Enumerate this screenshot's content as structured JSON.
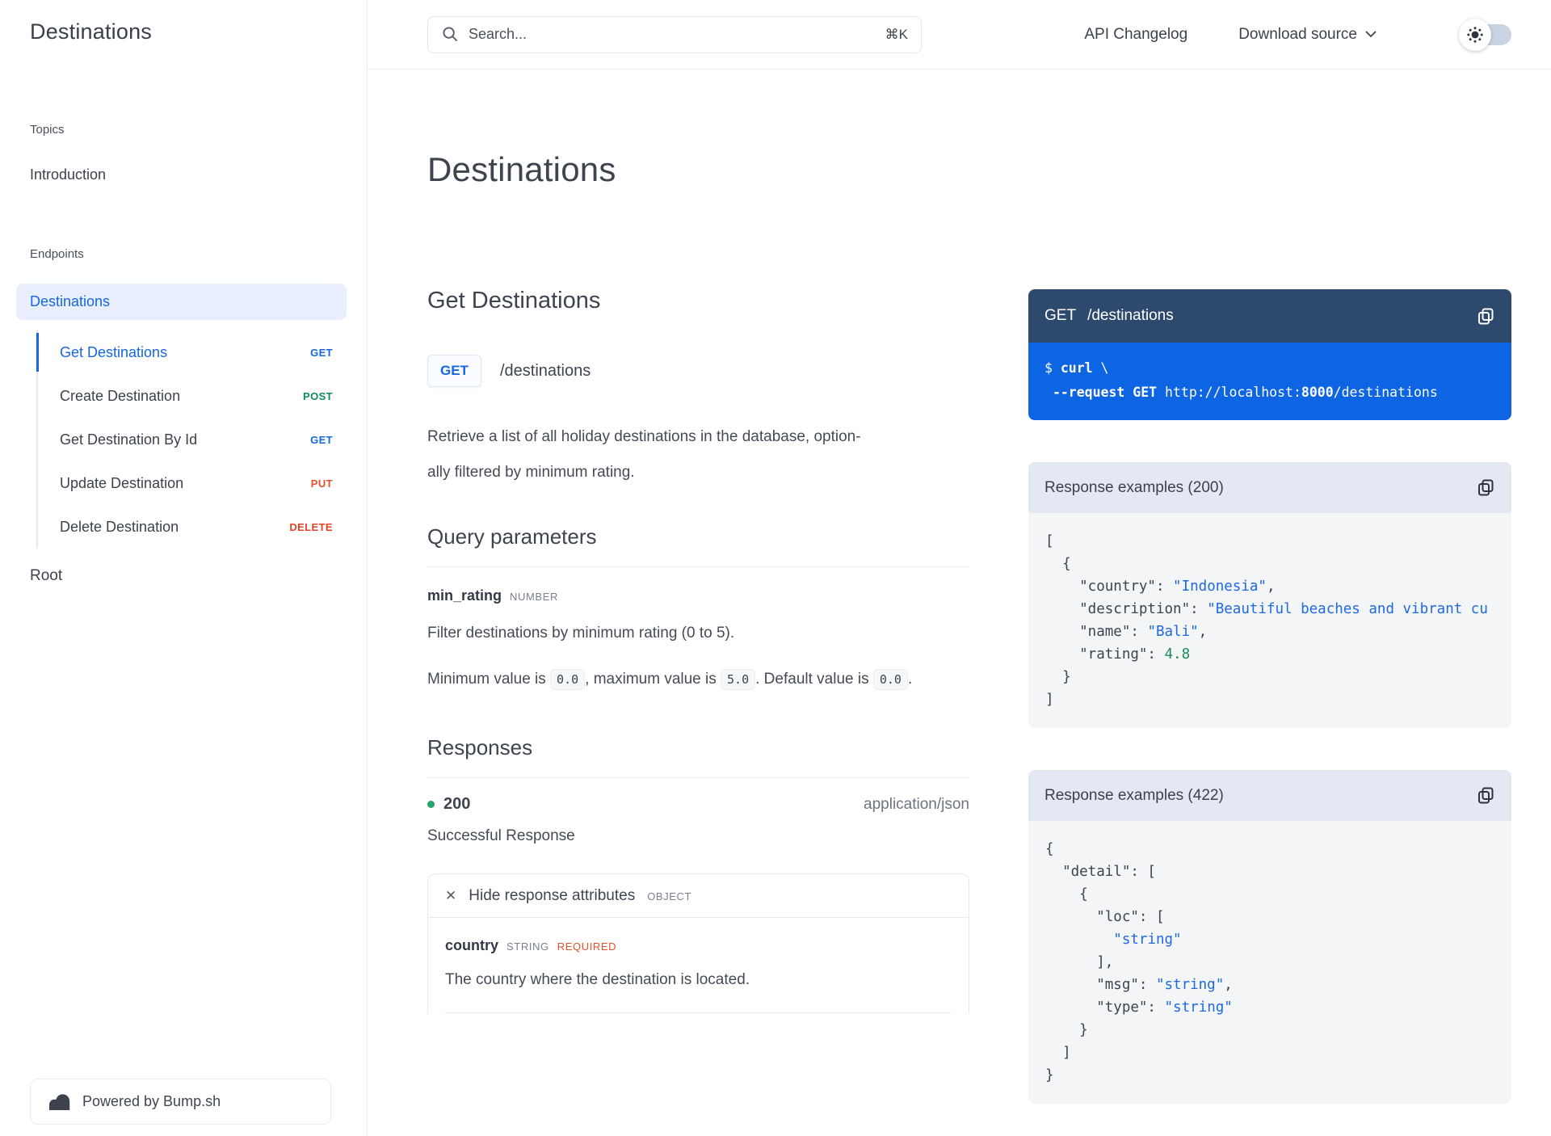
{
  "colors": {
    "accent_blue": "#1667e0",
    "method_get": "#1667e0",
    "method_post": "#118a5c",
    "method_put": "#e0532d",
    "method_delete": "#e2432b",
    "required_orange": "#e0502c",
    "status_dot_green": "#27a36b",
    "json_string_blue": "#1f6ae0",
    "json_number_green": "#1e8a55",
    "curl_header_navy": "#2d4a6e",
    "curl_body_blue": "#0d65e4",
    "example_header_bg": "#e3e8f3",
    "example_body_bg": "#f3f5f7",
    "active_item_bg": "#e8eefb"
  },
  "icons": {
    "search": "magnifier",
    "chevron_down": "chevron",
    "sun": "sun-with-rays",
    "copy": "overlapping-squares",
    "close": "✕",
    "bump_logo": "two-bumps",
    "status_dot": "●"
  },
  "topbar": {
    "search_placeholder": "Search...",
    "search_shortcut": "⌘K",
    "api_changelog": "API Changelog",
    "download_source": "Download source"
  },
  "sidebar": {
    "brand": "Destinations",
    "topics_label": "Topics",
    "introduction": "Introduction",
    "endpoints_label": "Endpoints",
    "group": "Destinations",
    "operations": [
      {
        "label": "Get Destinations",
        "method": "GET"
      },
      {
        "label": "Create Destination",
        "method": "POST"
      },
      {
        "label": "Get Destination By Id",
        "method": "GET"
      },
      {
        "label": "Update Destination",
        "method": "PUT"
      },
      {
        "label": "Delete Destination",
        "method": "DELETE"
      }
    ],
    "root": "Root",
    "powered_by": "Powered by Bump.sh"
  },
  "main": {
    "title": "Destinations",
    "operation": {
      "title": "Get Destinations",
      "method": "GET",
      "path": "/destinations",
      "description_lines": [
        "Retrieve a list of all holiday destinations in the database, option-",
        "ally filtered by minimum rating."
      ],
      "query_parameters_heading": "Query parameters",
      "parameter": {
        "name": "min_rating",
        "type": "NUMBER",
        "description": "Filter destinations by minimum rating (0 to 5).",
        "constraints": {
          "t1": "Minimum value is",
          "v1": "0.0",
          "t2": ", maximum value is",
          "v2": "5.0",
          "t3": ". Default value is",
          "v3": "0.0",
          "t4": "."
        }
      },
      "responses_heading": "Responses",
      "response": {
        "status": "200",
        "content_type": "application/json",
        "description": "Successful Response",
        "attributes_toggle": "Hide response attributes",
        "attributes_kind": "OBJECT",
        "attributes": [
          {
            "name": "country",
            "type": "STRING",
            "required": "REQUIRED",
            "description": "The country where the destination is located."
          }
        ]
      }
    }
  },
  "examples": {
    "request": {
      "method": "GET",
      "path": "/destinations",
      "code": [
        [
          {
            "t": "$ ",
            "c": "w"
          },
          {
            "t": "curl",
            "c": "wb"
          },
          {
            "t": " \\",
            "c": "w"
          }
        ],
        [
          {
            "t": " ",
            "c": "w"
          },
          {
            "t": "--request GET",
            "c": "wb"
          },
          {
            "t": " http://localhost:",
            "c": "w"
          },
          {
            "t": "8000",
            "c": "wb"
          },
          {
            "t": "/destinations",
            "c": "w"
          }
        ]
      ]
    },
    "response_200": {
      "title": "Response examples (200)",
      "code": [
        [
          {
            "t": "[",
            "c": "p"
          }
        ],
        [
          {
            "t": "  {",
            "c": "p"
          }
        ],
        [
          {
            "t": "    \"country\": ",
            "c": "p"
          },
          {
            "t": "\"Indonesia\"",
            "c": "s"
          },
          {
            "t": ",",
            "c": "p"
          }
        ],
        [
          {
            "t": "    \"description\": ",
            "c": "p"
          },
          {
            "t": "\"Beautiful beaches and vibrant cu",
            "c": "s"
          }
        ],
        [
          {
            "t": "    \"name\": ",
            "c": "p"
          },
          {
            "t": "\"Bali\"",
            "c": "s"
          },
          {
            "t": ",",
            "c": "p"
          }
        ],
        [
          {
            "t": "    \"rating\": ",
            "c": "p"
          },
          {
            "t": "4.8",
            "c": "n"
          }
        ],
        [
          {
            "t": "  }",
            "c": "p"
          }
        ],
        [
          {
            "t": "]",
            "c": "p"
          }
        ]
      ]
    },
    "response_422": {
      "title": "Response examples (422)",
      "code": [
        [
          {
            "t": "{",
            "c": "p"
          }
        ],
        [
          {
            "t": "  \"detail\": [",
            "c": "p"
          }
        ],
        [
          {
            "t": "    {",
            "c": "p"
          }
        ],
        [
          {
            "t": "      \"loc\": [",
            "c": "p"
          }
        ],
        [
          {
            "t": "        ",
            "c": "p"
          },
          {
            "t": "\"string\"",
            "c": "s"
          }
        ],
        [
          {
            "t": "      ],",
            "c": "p"
          }
        ],
        [
          {
            "t": "      \"msg\": ",
            "c": "p"
          },
          {
            "t": "\"string\"",
            "c": "s"
          },
          {
            "t": ",",
            "c": "p"
          }
        ],
        [
          {
            "t": "      \"type\": ",
            "c": "p"
          },
          {
            "t": "\"string\"",
            "c": "s"
          }
        ],
        [
          {
            "t": "    }",
            "c": "p"
          }
        ],
        [
          {
            "t": "  ]",
            "c": "p"
          }
        ],
        [
          {
            "t": "}",
            "c": "p"
          }
        ]
      ]
    }
  }
}
